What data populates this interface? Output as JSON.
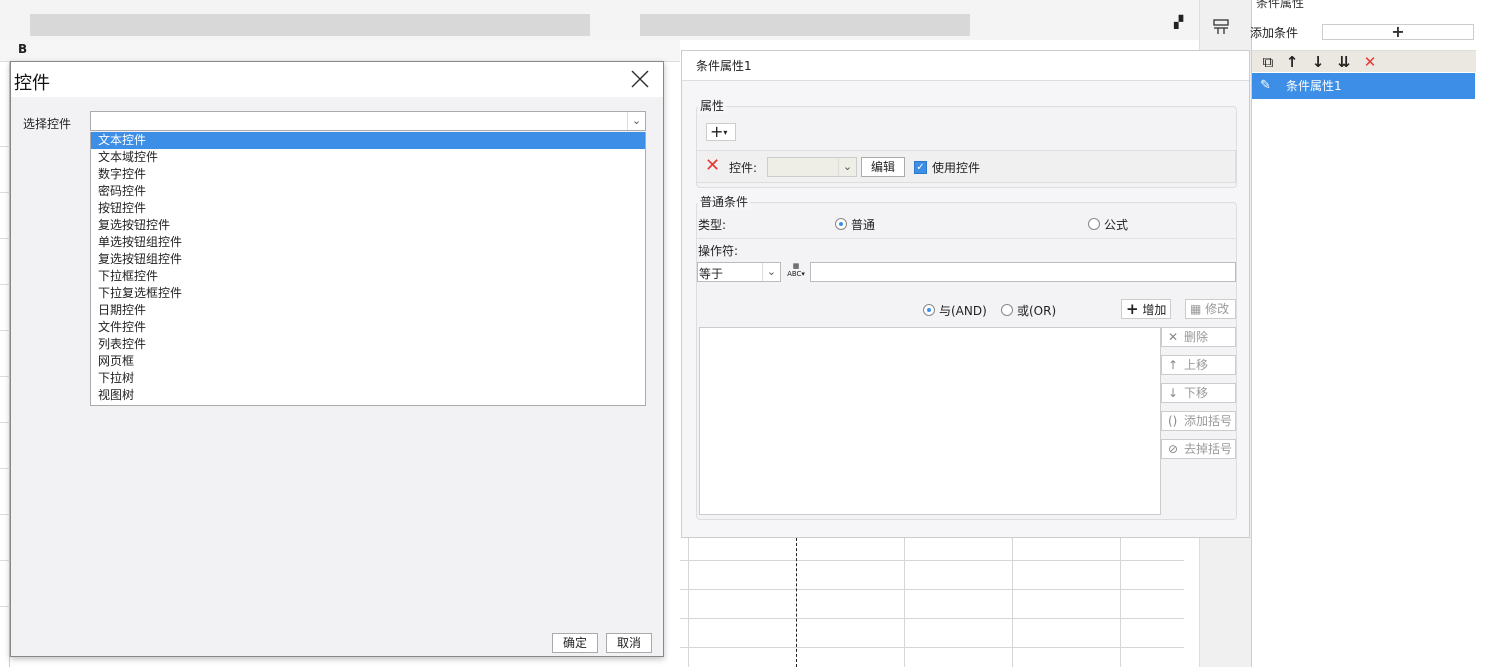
{
  "dialog": {
    "title": "控件",
    "select_label": "选择控件",
    "select_value": "",
    "options": [
      "文本控件",
      "文本域控件",
      "数字控件",
      "密码控件",
      "按钮控件",
      "复选按钮控件",
      "单选按钮组控件",
      "复选按钮组控件",
      "下拉框控件",
      "下拉复选框控件",
      "日期控件",
      "文件控件",
      "列表控件",
      "网页框",
      "下拉树",
      "视图树"
    ],
    "active_option": "文本控件",
    "ok_label": "确定",
    "cancel_label": "取消"
  },
  "condition_panel": {
    "title": "条件属性1",
    "properties_group": "属性",
    "plus_label": "+",
    "plus_caret": "▾",
    "widget_label": "控件:",
    "edit_label": "编辑",
    "use_widget_label": "使用控件",
    "use_widget_checked": true,
    "normal_group": "普通条件",
    "type_label": "类型:",
    "type_normal": "普通",
    "type_formula": "公式",
    "operator_label": "操作符:",
    "operator_value": "等于",
    "and_label": "与(AND)",
    "or_label": "或(OR)",
    "add_label": "增加",
    "modify_label": "修改",
    "delete_label": "删除",
    "move_up_label": "上移",
    "move_down_label": "下移",
    "add_bracket_label": "添加括号",
    "remove_bracket_label": "去掉括号"
  },
  "right_panel": {
    "header": "条件属性",
    "add_condition_label": "添加条件",
    "add_symbol": "+",
    "selected_item": "条件属性1"
  },
  "colors": {
    "accent": "#3d8ee6",
    "danger": "#e53935",
    "toolbar_bg": "#ebe8e1"
  }
}
